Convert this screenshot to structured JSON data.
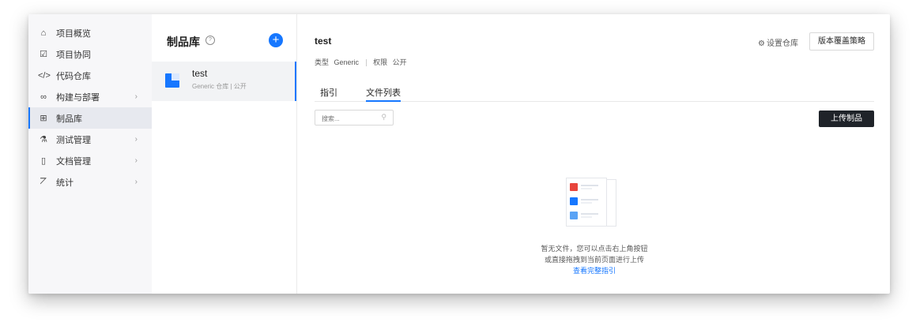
{
  "nav": {
    "items": [
      {
        "icon": "home-icon",
        "glyph": "⌂",
        "label": "项目概览",
        "chevron": false,
        "active": false
      },
      {
        "icon": "checkbox-icon",
        "glyph": "☑",
        "label": "项目协同",
        "chevron": false,
        "active": false
      },
      {
        "icon": "code-icon",
        "glyph": "</>",
        "label": "代码仓库",
        "chevron": false,
        "active": false
      },
      {
        "icon": "infinity-icon",
        "glyph": "∞",
        "label": "构建与部署",
        "chevron": true,
        "active": false
      },
      {
        "icon": "package-icon",
        "glyph": "⊞",
        "label": "制品库",
        "chevron": false,
        "active": true
      },
      {
        "icon": "flask-icon",
        "glyph": "⚗",
        "label": "测试管理",
        "chevron": true,
        "active": false
      },
      {
        "icon": "document-icon",
        "glyph": "▯",
        "label": "文档管理",
        "chevron": true,
        "active": false
      },
      {
        "icon": "chart-icon",
        "glyph": "⦢",
        "label": "统计",
        "chevron": true,
        "active": false
      }
    ],
    "chevron_glyph": "›"
  },
  "repo_panel": {
    "title": "制品库",
    "help_glyph": "?",
    "add_glyph": "+",
    "repos": [
      {
        "name": "test",
        "meta": "Generic 仓库 | 公开"
      }
    ]
  },
  "main": {
    "title": "test",
    "meta": {
      "type_label": "类型",
      "type_value": "Generic",
      "perm_label": "权限",
      "perm_value": "公开"
    },
    "settings_label": "设置仓库",
    "settings_glyph": "⚙",
    "policy_button": "版本覆盖策略",
    "tabs": [
      {
        "label": "指引",
        "active": false
      },
      {
        "label": "文件列表",
        "active": true
      }
    ],
    "search_placeholder": "搜索...",
    "search_glyph": "⚲",
    "upload_button": "上传制品",
    "empty": {
      "line1": "暂无文件，您可以点击右上角按钮",
      "line2": "或直接拖拽到当前页面进行上传",
      "link": "查看完整指引"
    }
  },
  "colors": {
    "accent": "#1677ff",
    "dark_button": "#1f2329",
    "illus_red": "#e8453c",
    "illus_blue": "#1677ff",
    "illus_lightblue": "#5aa3f5"
  }
}
